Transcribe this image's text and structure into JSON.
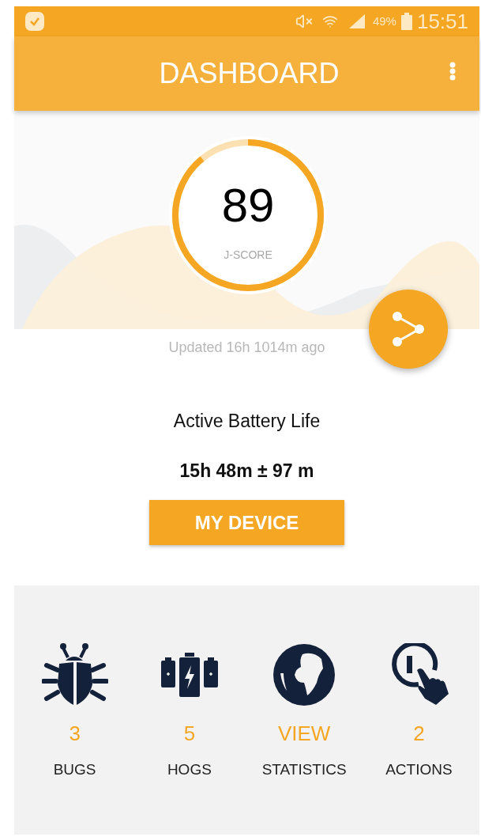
{
  "status_bar": {
    "battery": "49%",
    "time": "15:51"
  },
  "app_bar": {
    "title": "DASHBOARD"
  },
  "score": {
    "value": "89",
    "label": "J-SCORE"
  },
  "updated": "Updated 16h 1014m ago",
  "battery_life": {
    "title": "Active Battery Life",
    "value": "15h 48m ± 97 m"
  },
  "device_button": "MY DEVICE",
  "stats": [
    {
      "value": "3",
      "label": "BUGS"
    },
    {
      "value": "5",
      "label": "HOGS"
    },
    {
      "value": "VIEW",
      "label": "STATISTICS"
    },
    {
      "value": "2",
      "label": "ACTIONS"
    }
  ]
}
